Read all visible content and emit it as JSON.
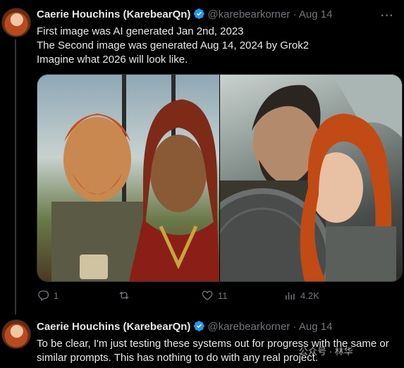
{
  "tweets": [
    {
      "author_name": "Caerie Houchins (KarebearQn)",
      "handle": "@karebearkorner",
      "separator": "·",
      "date": "Aug 14",
      "more_icon": "ellipsis-icon",
      "text": "First image was AI generated Jan 2nd, 2023\nThe Second image was generated Aug 14, 2024 by Grok2\nImagine what 2026 will look like.",
      "actions": {
        "reply_count": "1",
        "repost_count": "",
        "like_count": "11",
        "views_count": "4.2K"
      }
    },
    {
      "author_name": "Caerie Houchins (KarebearQn)",
      "handle": "@karebearkorner",
      "separator": "·",
      "date": "Aug 14",
      "text": "To be clear, I'm just testing these systems out for progress with the same or similar prompts. This has nothing to do with any real project."
    }
  ],
  "watermark": "公众号 · 林华",
  "colors": {
    "verified": "#1d9bf0",
    "muted": "#71767b",
    "background": "#000000"
  }
}
